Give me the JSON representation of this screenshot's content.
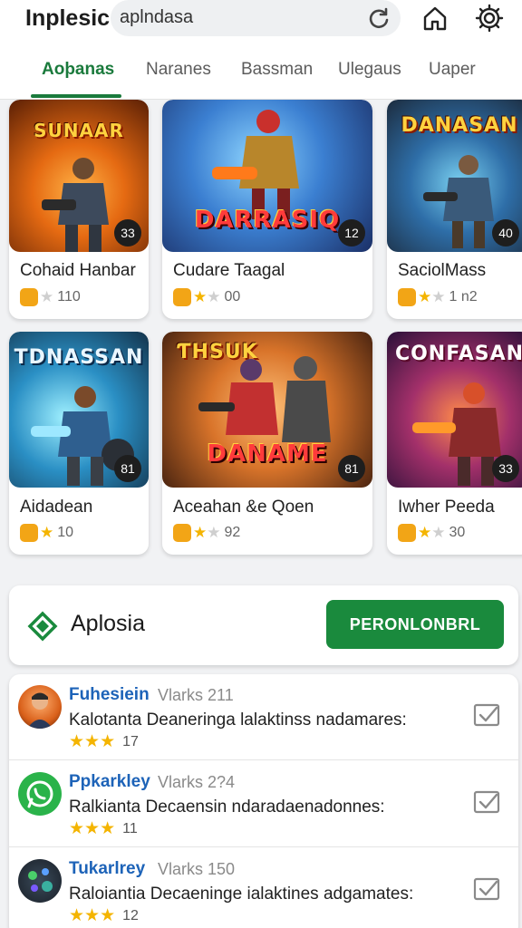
{
  "header": {
    "app_name": "Inplesic",
    "search_value": "aplndasa"
  },
  "tabs": [
    {
      "label": "Aoþanas",
      "active": true
    },
    {
      "label": "Naranes",
      "active": false
    },
    {
      "label": "Bassman",
      "active": false
    },
    {
      "label": "Ulegaus",
      "active": false
    },
    {
      "label": "Uaper",
      "active": false
    }
  ],
  "games": [
    {
      "art_title": "SUNAAR",
      "badge": "33",
      "title": "Cohaid Hanbar",
      "stars_filled": 0,
      "rating": "110"
    },
    {
      "art_title": "DARRASIQ",
      "badge": "12",
      "title": "Cudare Taagal",
      "stars_filled": 1,
      "rating": "00"
    },
    {
      "art_title": "DANASAN",
      "badge": "40",
      "title": "SaciolMass",
      "stars_filled": 1,
      "rating": "1 n2"
    },
    {
      "art_title": "TDNASSAN",
      "badge": "81",
      "title": "Aidadean",
      "stars_filled": 1,
      "rating": "10"
    },
    {
      "art_title": "DANAME",
      "badge": "81",
      "title": "Aceahan &e Qoen",
      "stars_filled": 1,
      "rating": "92"
    },
    {
      "art_title": "CONFASAN",
      "badge": "33",
      "title": "Iwher Peeda",
      "stars_filled": 1,
      "rating": "30"
    }
  ],
  "promo": {
    "title": "Aplosia",
    "button_label": "PERONLONBRL"
  },
  "reviews": [
    {
      "name": "Fuhesiein",
      "meta": "Vlarks 211",
      "text": "Kalotanta Deaneringa lalaktinss nadamares:",
      "stars": 3,
      "count": "17"
    },
    {
      "name": "Ppkarkley",
      "meta": "Vlarks 2?4",
      "text": "Ralkianta Decaensin ndaradaenadonnes:",
      "stars": 3,
      "count": "11"
    },
    {
      "name": "Tukarlrey",
      "meta": "Vlarks 150",
      "text": "Raloiantia Decaeninge ialaktines adgamates:",
      "stars": 3,
      "count": "12"
    }
  ],
  "colors": {
    "accent": "#1a7a3c",
    "button": "#1a8a3d",
    "link_name": "#1d63b8",
    "star": "#f4b400"
  }
}
